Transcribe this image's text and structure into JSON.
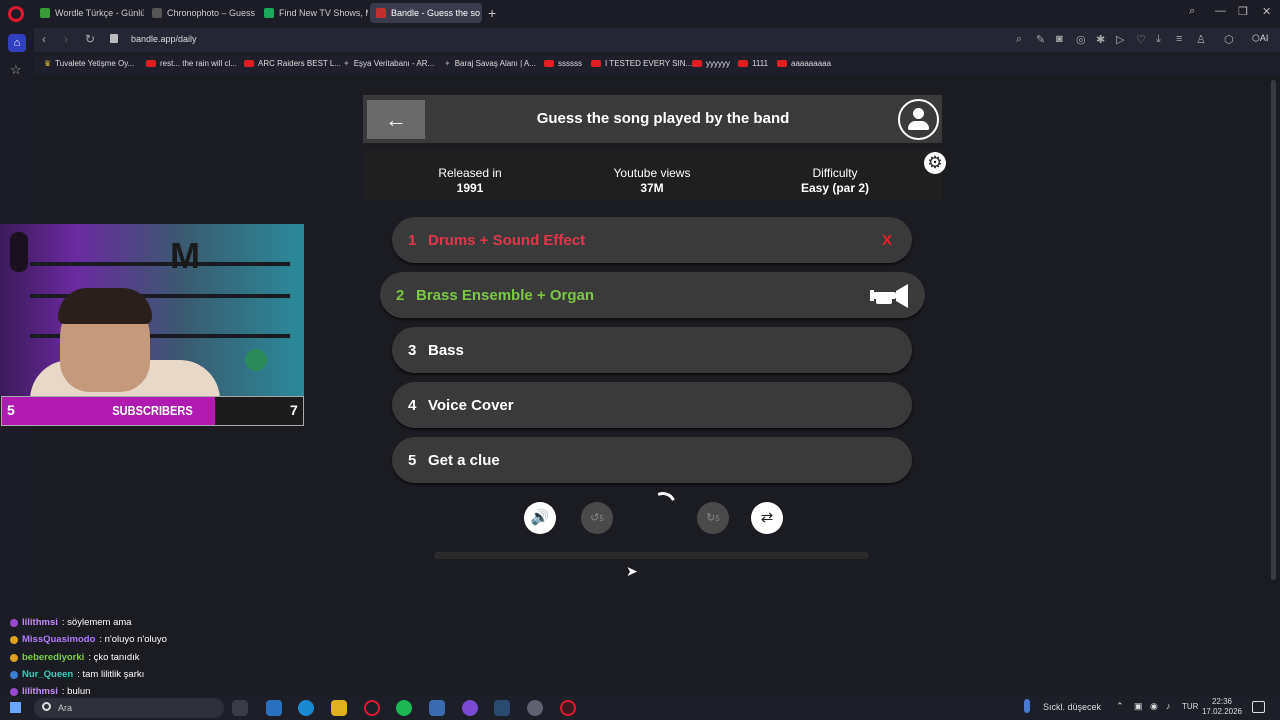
{
  "browser": {
    "tabs": [
      {
        "label": "Wordle Türkçe - Günlük K",
        "color": "#3a9a3a"
      },
      {
        "label": "Chronophoto – Guess the",
        "color": "#555"
      },
      {
        "label": "Find New TV Shows, Mov",
        "color": "#1aa85a"
      },
      {
        "label": "Bandle - Guess the so",
        "color": "#c03030",
        "active": true
      }
    ],
    "url": "bandle.app/daily",
    "bookmarks": [
      "Tuvalete Yetişme Oy...",
      "rest... the rain will cl...",
      "ARC Raiders BEST L...",
      "Eşya Veritabanı - AR...",
      "Baraj Savaş Alanı | A...",
      "ssssss",
      "I TESTED EVERY SIN...",
      "yyyyyy",
      "1111",
      "aaaaaaaaa"
    ]
  },
  "game": {
    "title": "Guess the song played by the band",
    "back_icon": "←",
    "info": {
      "released_label": "Released in",
      "released_value": "1991",
      "views_label": "Youtube views",
      "views_value": "37M",
      "difficulty_label": "Difficulty",
      "difficulty_value": "Easy (par 2)"
    },
    "clues": [
      {
        "num": "1",
        "label": "Drums + Sound Effect",
        "state": "wrong",
        "mark": "X"
      },
      {
        "num": "2",
        "label": "Brass Ensemble + Organ",
        "state": "current"
      },
      {
        "num": "3",
        "label": "Bass",
        "state": "locked"
      },
      {
        "num": "4",
        "label": "Voice Cover",
        "state": "locked"
      },
      {
        "num": "5",
        "label": "Get a clue",
        "state": "locked"
      }
    ],
    "controls": {
      "rewind_label": "5",
      "forward_label": "5"
    },
    "colors": {
      "wrong": "#e0384a",
      "current": "#7ac943"
    }
  },
  "stream": {
    "sub_current": "5",
    "sub_label": "SUBSCRIBERS",
    "sub_goal": "7",
    "sub_progress": 0.71,
    "chat": [
      {
        "user": "lilithmsi",
        "msg": ": söylemem ama",
        "color": "#c78bff"
      },
      {
        "user": "MissQuasimodo",
        "msg": ": n'oluyo n'oluyo",
        "color": "#b27aff"
      },
      {
        "user": "beberediyorki",
        "msg": ": çko tanıdık",
        "color": "#7ad04a"
      },
      {
        "user": "Nur_Queen",
        "msg": ": tam lilitlik şarkı",
        "color": "#3ad0c0"
      },
      {
        "user": "lilithmsi",
        "msg": ": bulun",
        "color": "#c78bff"
      }
    ]
  },
  "taskbar": {
    "search": "Ara",
    "weather": "Sıckl. düşecek",
    "lang": "TUR",
    "time": "22:36",
    "date": "17.02.2026"
  }
}
